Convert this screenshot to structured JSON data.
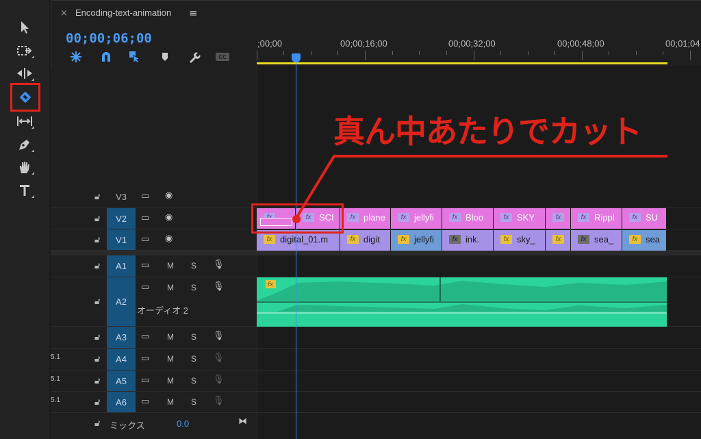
{
  "sequence": {
    "tab_close": "×",
    "tab_title": "Encoding-text-animation",
    "tab_menu": "≡",
    "timecode": "00;00;06;00"
  },
  "ruler": {
    "labels": [
      ";00;00",
      "00;00;16;00",
      "00;00;32;00",
      "00;00;48;00",
      "00;01;04"
    ]
  },
  "annotation": {
    "text": "真ん中あたりでカット"
  },
  "tracks": {
    "v3": "V3",
    "v2": "V2",
    "v1": "V1",
    "a1": "A1",
    "a2": "A2",
    "a2_label": "オーディオ 2",
    "a3": "A3",
    "a4": "A4",
    "a5": "A5",
    "a6": "A6",
    "mix_label": "ミックス",
    "mix_value": "0.0",
    "m": "M",
    "s": "S",
    "tag51": "5.1"
  },
  "clips": {
    "v2": [
      "",
      "SCI",
      "plane",
      "jellyfi",
      "Bloo",
      "SKY",
      "",
      "Rippl",
      "SU"
    ],
    "v1": [
      "digital_01.m",
      "digit",
      "jellyfi",
      "ink.",
      "sky_",
      "",
      "sea_",
      "sea"
    ]
  },
  "colors": {
    "accent": "#3e8df0",
    "annotation": "#e0231a",
    "v2_clip": "#e377df",
    "v1_clip": "#a591e6",
    "audio_clip": "#2bd49b",
    "work_area": "#e6dc23"
  },
  "icons": {
    "toolbar": [
      "selection-tool-icon",
      "track-select-icon",
      "ripple-edit-icon",
      "razor-tool-icon",
      "slip-tool-icon",
      "pen-tool-icon",
      "hand-tool-icon",
      "type-tool-icon"
    ]
  }
}
